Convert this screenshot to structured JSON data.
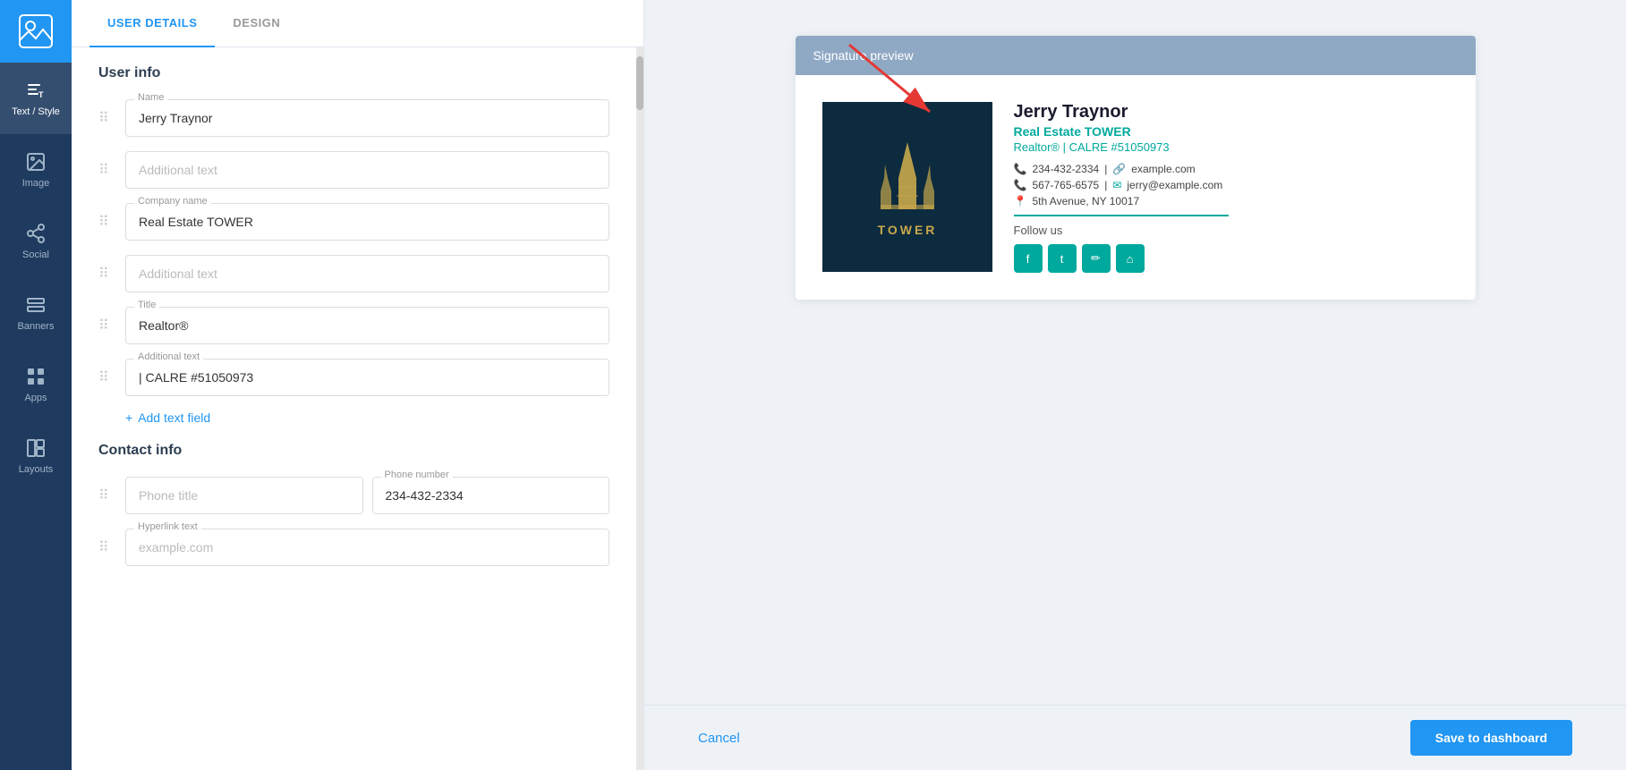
{
  "sidebar": {
    "logo_label": "Logo",
    "items": [
      {
        "id": "text-style",
        "label": "Text / Style",
        "icon": "text-icon"
      },
      {
        "id": "image",
        "label": "Image",
        "icon": "image-icon"
      },
      {
        "id": "social",
        "label": "Social",
        "icon": "social-icon"
      },
      {
        "id": "banners",
        "label": "Banners",
        "icon": "banners-icon"
      },
      {
        "id": "apps",
        "label": "Apps",
        "icon": "apps-icon"
      },
      {
        "id": "layouts",
        "label": "Layouts",
        "icon": "layouts-icon"
      }
    ]
  },
  "tabs": [
    {
      "id": "user-details",
      "label": "USER DETAILS",
      "active": true
    },
    {
      "id": "design",
      "label": "DESIGN",
      "active": false
    }
  ],
  "form": {
    "sections": [
      {
        "id": "user-info",
        "title": "User info",
        "fields": [
          {
            "id": "name",
            "label": "Name",
            "value": "Jerry Traynor",
            "placeholder": ""
          },
          {
            "id": "additional-text-1",
            "label": "",
            "value": "",
            "placeholder": "Additional text"
          },
          {
            "id": "company-name",
            "label": "Company name",
            "value": "Real Estate TOWER",
            "placeholder": ""
          },
          {
            "id": "additional-text-2",
            "label": "",
            "value": "",
            "placeholder": "Additional text"
          },
          {
            "id": "title",
            "label": "Title",
            "value": "Realtor®",
            "placeholder": ""
          },
          {
            "id": "additional-text-3",
            "label": "Additional text",
            "value": "| CALRE #51050973",
            "placeholder": ""
          }
        ],
        "add_field_label": "Add text field"
      },
      {
        "id": "contact-info",
        "title": "Contact info",
        "fields": []
      }
    ],
    "phone_title_placeholder": "Phone title",
    "phone_number_label": "Phone number",
    "phone_number_value": "234-432-2334",
    "hyperlink_text_label": "Hyperlink text",
    "hyperlink_text_placeholder": "example.com"
  },
  "preview": {
    "header": "Signature preview",
    "signature": {
      "name": "Jerry Traynor",
      "company": "Real Estate TOWER",
      "role": "Realtor® | CALRE #51050973",
      "phone1": "234-432-2334",
      "website": "example.com",
      "phone2": "567-765-6575",
      "email": "jerry@example.com",
      "address": "5th Avenue, NY 10017",
      "follow_label": "Follow us",
      "social_icons": [
        "f",
        "t",
        "✏",
        "🏠"
      ]
    }
  },
  "actions": {
    "cancel_label": "Cancel",
    "save_label": "Save to dashboard"
  }
}
